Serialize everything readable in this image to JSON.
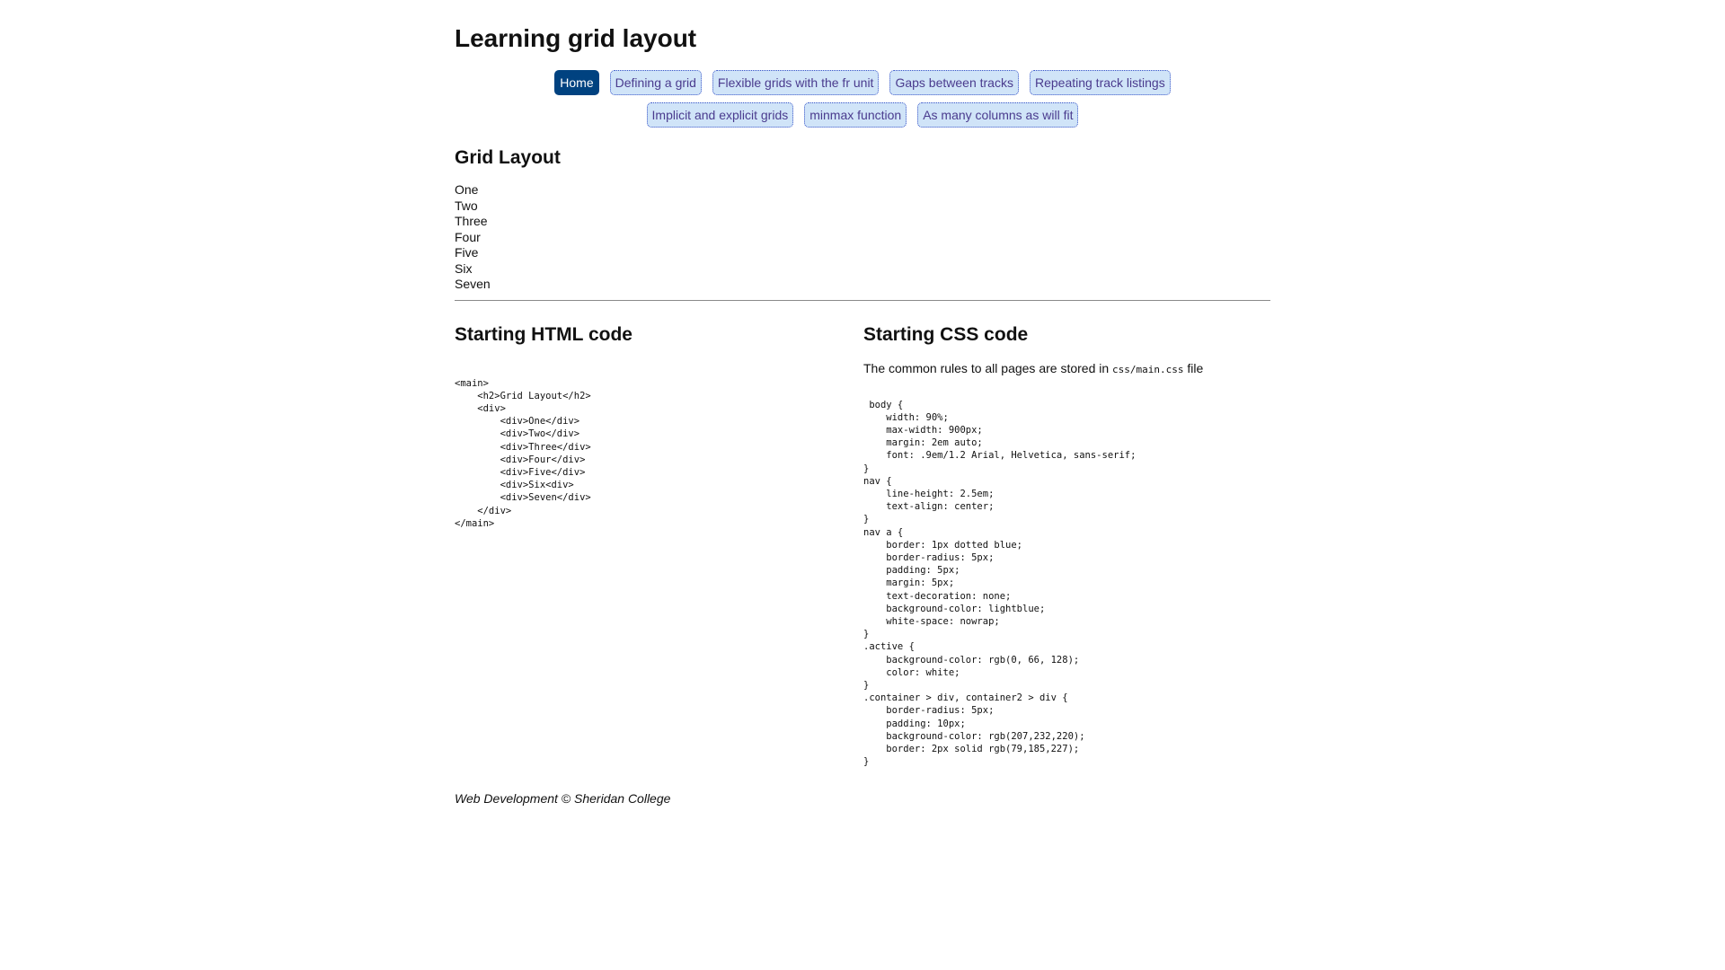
{
  "header": {
    "title": "Learning grid layout"
  },
  "nav": {
    "row1": [
      {
        "label": "Home",
        "active": true
      },
      {
        "label": "Defining a grid",
        "active": false
      },
      {
        "label": "Flexible grids with the fr unit",
        "active": false
      },
      {
        "label": "Gaps between tracks",
        "active": false
      },
      {
        "label": "Repeating track listings",
        "active": false
      }
    ],
    "row2": [
      {
        "label": "Implicit and explicit grids",
        "active": false
      },
      {
        "label": "minmax function",
        "active": false
      },
      {
        "label": "As many columns as will fit",
        "active": false
      }
    ]
  },
  "grid": {
    "heading": "Grid Layout",
    "items": [
      "One",
      "Two",
      "Three",
      "Four",
      "Five",
      "Six",
      "Seven"
    ]
  },
  "html_section": {
    "heading": "Starting HTML code",
    "code": "<main>\n    <h2>Grid Layout</h2>\n    <div>\n        <div>One</div>\n        <div>Two</div>\n        <div>Three</div>\n        <div>Four</div>\n        <div>Five</div>\n        <div>Six<div>\n        <div>Seven</div>\n    </div>\n</main>"
  },
  "css_section": {
    "heading": "Starting CSS code",
    "intro_before": "The common rules to all pages are stored in ",
    "intro_code": "css/main.css",
    "intro_after": " file",
    "code": " body {\n    width: 90%;\n    max-width: 900px;\n    margin: 2em auto;\n    font: .9em/1.2 Arial, Helvetica, sans-serif;\n}\nnav {\n    line-height: 2.5em;\n    text-align: center;\n}\nnav a {\n    border: 1px dotted blue;\n    border-radius: 5px;\n    padding: 5px;\n    margin: 5px;\n    text-decoration: none;\n    background-color: lightblue;\n    white-space: nowrap;\n}\n.active {\n    background-color: rgb(0, 66, 128);\n    color: white;\n}\n.container > div, container2 > div {\n    border-radius: 5px;\n    padding: 10px;\n    background-color: rgb(207,232,220);\n    border: 2px solid rgb(79,185,227);\n}"
  },
  "footer": {
    "text": "Web Development © Sheridan College"
  },
  "colors": {
    "active_bg": "#004280",
    "nav_bg": "#d0e4f8",
    "nav_text": "#4a3b8e",
    "divider": "#8a8a8a"
  }
}
